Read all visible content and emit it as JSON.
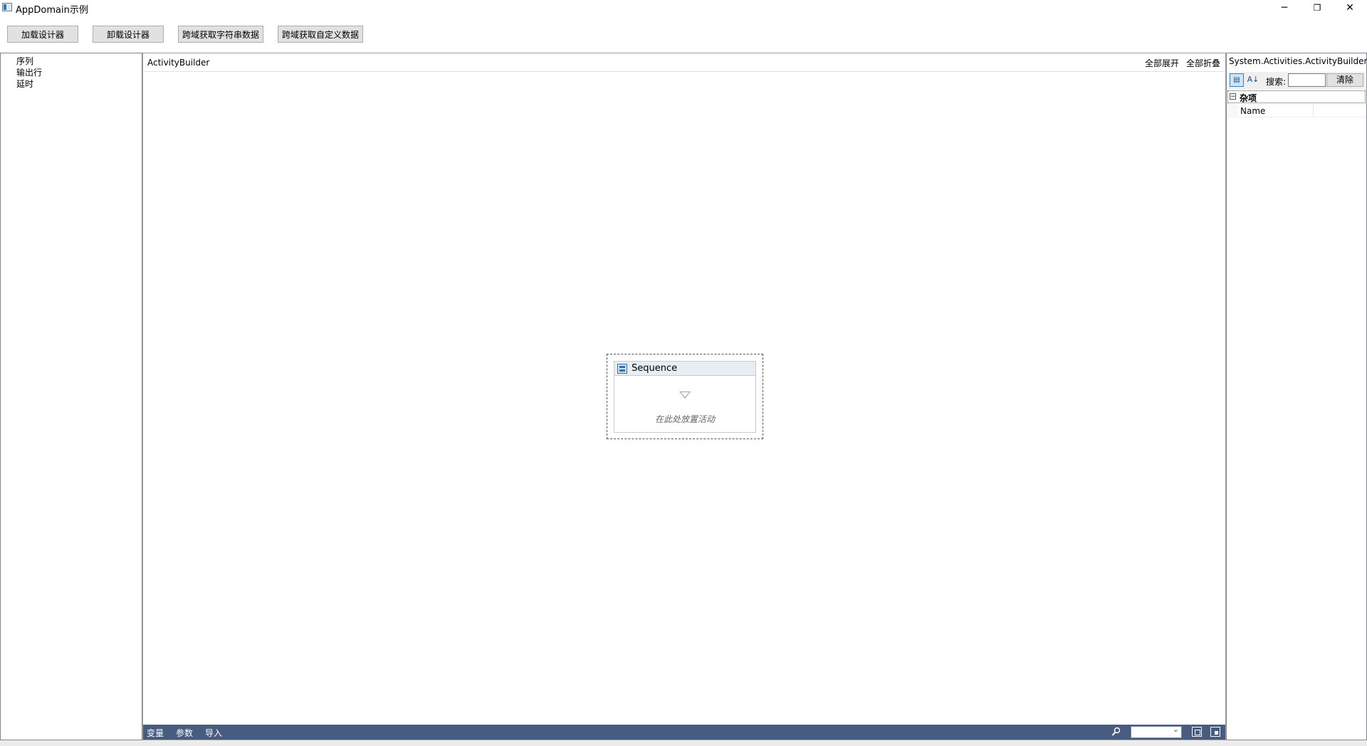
{
  "window": {
    "title": "AppDomain示例",
    "minimize": "─",
    "restore": "❐",
    "close": "✕"
  },
  "toolbar": {
    "load_designer": "加载设计器",
    "unload_designer": "卸载设计器",
    "cross_domain_string": "跨域获取字符串数据",
    "cross_domain_custom": "跨域获取自定义数据"
  },
  "toolbox": {
    "items": [
      "序列",
      "输出行",
      "延时"
    ]
  },
  "designer": {
    "breadcrumb": "ActivityBuilder",
    "expand_all": "全部展开",
    "collapse_all": "全部折叠",
    "sequence": {
      "title": "Sequence",
      "drop_hint": "在此处放置活动"
    },
    "footer": {
      "variables": "变量",
      "arguments": "参数",
      "imports": "导入",
      "zoom_value": ""
    }
  },
  "properties": {
    "type_name": "System.Activities.ActivityBuilder",
    "search_label": "搜索:",
    "search_value": "",
    "clear_label": "清除",
    "category": {
      "toggle": "−",
      "label": "杂项"
    },
    "rows": [
      {
        "name": "Name",
        "value": ""
      }
    ]
  }
}
